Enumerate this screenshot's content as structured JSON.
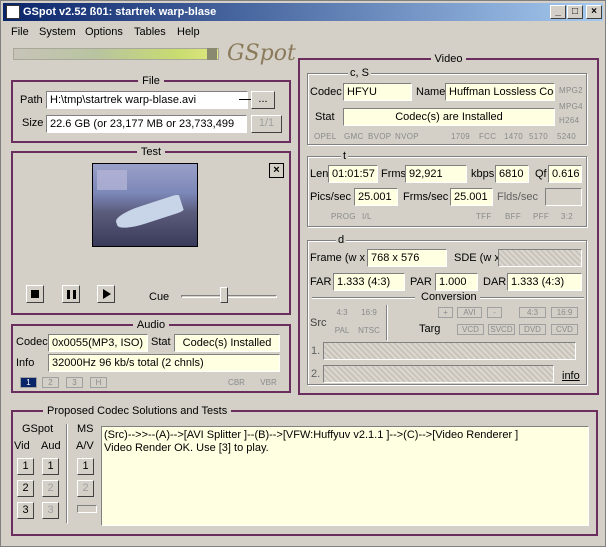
{
  "window": {
    "title": "GSpot v2.52 ß01: startrek warp-blase",
    "min": "_",
    "max": "□",
    "close": "×"
  },
  "menu": {
    "file": "File",
    "system": "System",
    "options": "Options",
    "tables": "Tables",
    "help": "Help"
  },
  "brand": "GSpot",
  "file": {
    "title": "File",
    "path_label": "Path",
    "path_value": "H:\\tmp\\startrek warp-blase.avi",
    "browse_label": "...",
    "size_label": "Size",
    "size_value": "22.6 GB (or 23,177 MB or 23,733,499",
    "page": "1/1"
  },
  "test": {
    "title": "Test",
    "cue_label": "Cue",
    "close": "×",
    "cue_level": 0.45
  },
  "audio": {
    "title": "Audio",
    "codec_label": "Codec",
    "codec_value": "0x0055(MP3, ISO)",
    "stat_label": "Stat",
    "stat_value": "Codec(s) Installed",
    "info_label": "Info",
    "info_value": "32000Hz  96 kb/s total (2 chnls)",
    "tracks": [
      "1",
      "2",
      "3",
      "H"
    ],
    "cbr": "CBR",
    "vbr": "VBR"
  },
  "video": {
    "title": "Video",
    "cs": {
      "title": "c, S",
      "codec_label": "Codec",
      "codec_value": "HFYU",
      "name_label": "Name",
      "name_value": "Huffman Lossless Cod",
      "stat_label": "Stat",
      "stat_value": "Codec(s) are Installed",
      "side": [
        "MPG2",
        "MPG4",
        "H264"
      ],
      "flags": [
        "OPEL",
        "GMC",
        "BVOP",
        "NVOP",
        "1709",
        "FCC",
        "1470",
        "5170",
        "5240"
      ]
    },
    "t": {
      "title": "t",
      "len_label": "Len",
      "len_value": "01:01:57",
      "frms_label": "Frms",
      "frms_value": "92,921",
      "kbps_label": "kbps",
      "kbps_value": "6810",
      "qf_label": "Qf",
      "qf_value": "0.616",
      "pics_label": "Pics/sec",
      "pics_value": "25.001",
      "frmsec_label": "Frms/sec",
      "frmsec_value": "25.001",
      "flds_label": "Flds/sec",
      "flags": [
        "PROG",
        "I/L",
        "TFF",
        "BFF",
        "PFF",
        "3:2"
      ]
    },
    "d": {
      "title": "d",
      "frame_label": "Frame (w x",
      "frame_value": "768 x 576",
      "sde_label": "SDE (w x",
      "far_label": "FAR",
      "far_value": "1.333 (4:3)",
      "par_label": "PAR",
      "par_value": "1.000",
      "dar_label": "DAR",
      "dar_value": "1.333 (4:3)",
      "conversion_title": "Conversion",
      "src_label": "Src",
      "targ_label": "Targ",
      "src_tags": [
        "4:3",
        "16:9",
        "PAL",
        "NTSC"
      ],
      "targ_top": [
        "+",
        "AVI",
        "-",
        "4:3",
        "16:9"
      ],
      "targ_bottom": [
        "VCD",
        "SVCD",
        "DVD",
        "CVD"
      ],
      "row1": "1.",
      "row2": "2.",
      "info_link": "info"
    }
  },
  "codec": {
    "title": "Proposed Codec Solutions and Tests",
    "gspot_label": "GSpot",
    "vid_label": "Vid",
    "aud_label": "Aud",
    "ms_label": "MS",
    "av_label": "A/V",
    "line1": "(Src)-->>--(A)-->[AVI Splitter ]--(B)-->[VFW:Huffyuv v2.1.1 ]-->(C)-->[Video Renderer ]",
    "line2": "Video Render OK. Use [3] to play.",
    "nums": [
      "1",
      "2",
      "3"
    ]
  }
}
